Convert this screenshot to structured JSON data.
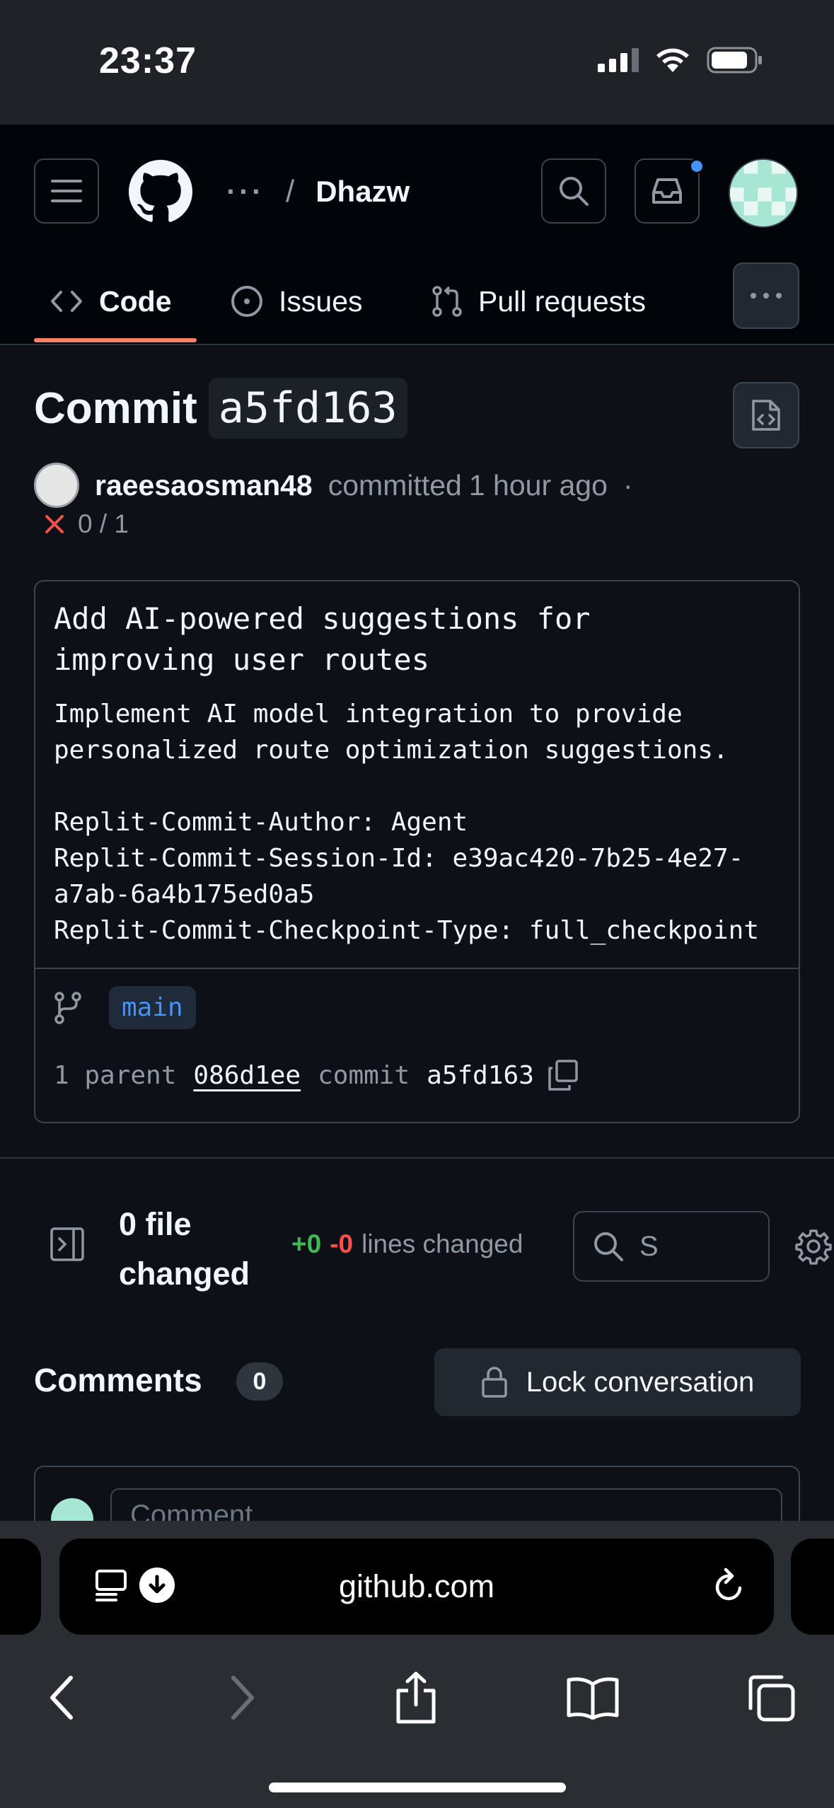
{
  "status_bar": {
    "time": "23:37"
  },
  "header": {
    "breadcrumb_ellipsis": "···",
    "breadcrumb_separator": "/",
    "repo_name": "Dhazw",
    "tabs": [
      {
        "label": "Code",
        "icon": "code-icon",
        "active": true
      },
      {
        "label": "Issues",
        "icon": "issue-opened-icon",
        "active": false
      },
      {
        "label": "Pull requests",
        "icon": "git-pull-request-icon",
        "active": false
      }
    ]
  },
  "commit": {
    "title_word": "Commit",
    "sha_short": "a5fd163",
    "author": "raeesaosman48",
    "action": "committed",
    "time_ago": "1 hour ago",
    "dot": "·",
    "checks": "0 / 1",
    "message_headline": "Add AI-powered suggestions for\nimproving user routes",
    "message_body": "Implement AI model integration to provide\npersonalized route optimization suggestions.\n\nReplit-Commit-Author: Agent\nReplit-Commit-Session-Id: e39ac420-7b25-4e27-\na7ab-6a4b175ed0a5\nReplit-Commit-Checkpoint-Type: full_checkpoint",
    "branch": "main",
    "parent_label": "1 parent",
    "parent_sha": "086d1ee",
    "commit_label": "commit",
    "commit_sha": "a5fd163"
  },
  "files": {
    "count_text": "0 file changed",
    "additions": "+0",
    "deletions": "-0",
    "lines_label": "lines changed",
    "filter_value": "S"
  },
  "comments": {
    "title": "Comments",
    "count": "0",
    "lock_label": "Lock conversation",
    "input_placeholder": "Comment"
  },
  "browser": {
    "url": "github.com"
  },
  "colors": {
    "accent_underline": "#f78166",
    "link_blue": "#4493f8",
    "addition_green": "#3fb950",
    "deletion_red": "#f85149"
  }
}
